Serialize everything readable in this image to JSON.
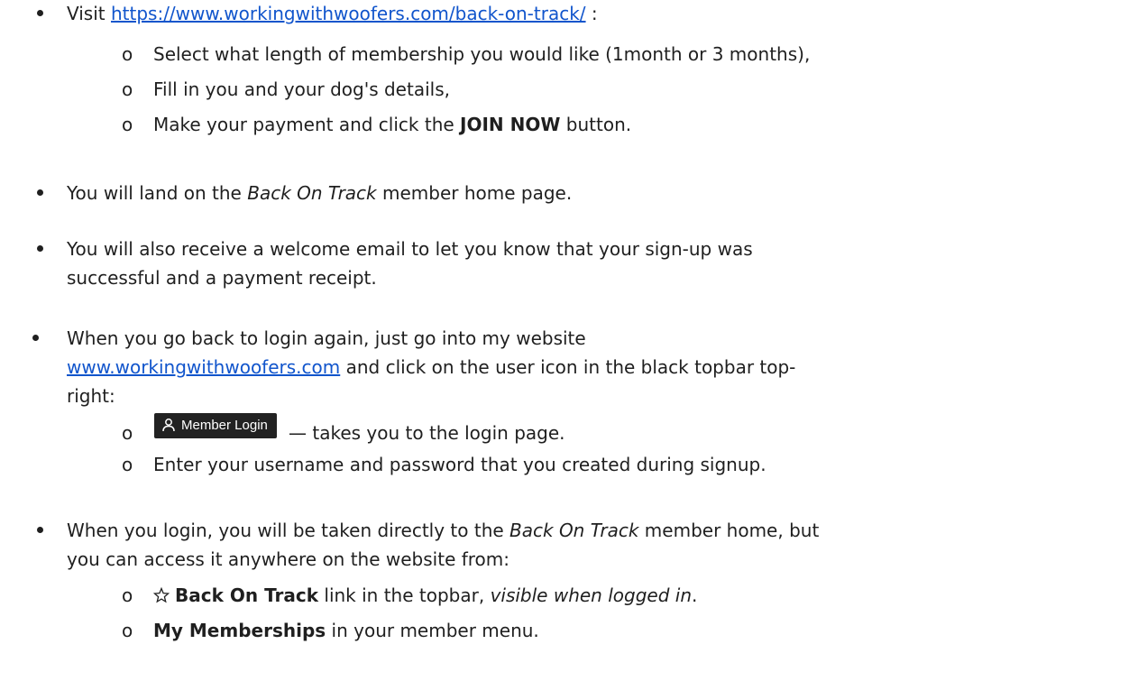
{
  "section1": {
    "visit_prefix": "Visit ",
    "visit_link": "https://www.workingwithwoofers.com/back-on-track/",
    "visit_suffix": " :",
    "sub_items": [
      "Select what length of membership you would like (1month or 3 months),",
      "Fill in you and your dog's details,"
    ],
    "payment_prefix": "Make your payment and click the ",
    "payment_bold": "JOIN NOW",
    "payment_suffix": " button."
  },
  "section2": {
    "prefix": "You will land on the ",
    "italic": "Back On Track",
    "suffix": " member home page."
  },
  "section3": {
    "line1": "You will also receive a welcome email to let you know that your sign-up was",
    "line2": "successful and a payment receipt."
  },
  "section4": {
    "line1": "When you go back to login again, just go into my website",
    "link": "www.workingwithwoofers.com",
    "line2_suffix": " and click on the user icon in the black topbar top-",
    "line3": "right:",
    "login_button_label": "Member Login",
    "login_button_icon": "user-icon",
    "login_desc": " — takes you to the login page.",
    "enter_creds": "Enter your username and password that you created during signup."
  },
  "section5": {
    "line1_prefix": "When you login, you will be taken directly to the ",
    "line1_italic": "Back On Track",
    "line1_suffix": " member home, but",
    "line2": "you can access it anywhere on the website from:",
    "star_icon": "star-icon",
    "bot_bold": "Back On Track",
    "bot_mid": " link in the topbar, ",
    "bot_italic": "visible when logged in",
    "bot_end": ".",
    "mem_bold": "My Memberships",
    "mem_suffix": " in your member menu."
  },
  "colors": {
    "link": "#1155cc",
    "text": "#1f1f1f",
    "button_bg": "#222222"
  },
  "markers": {
    "sub_bullet": "o"
  }
}
